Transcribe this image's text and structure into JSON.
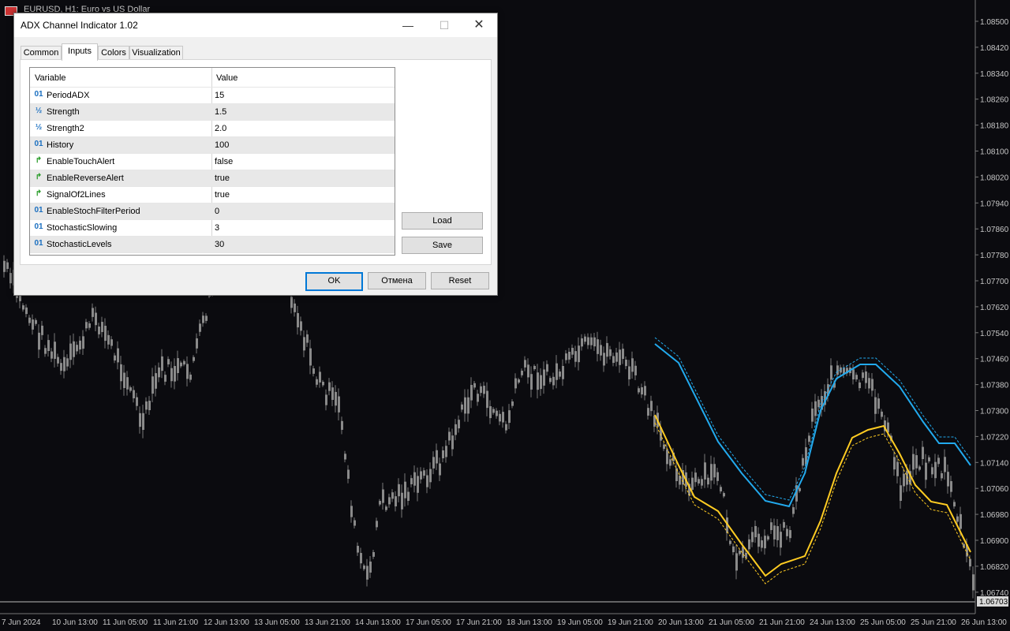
{
  "chart": {
    "title": "EURUSD, H1: Euro vs US Dollar",
    "current_price": "1.06703",
    "price_labels": [
      "1.08500",
      "1.08420",
      "1.08340",
      "1.08260",
      "1.08180",
      "1.08100",
      "1.08020",
      "1.07940",
      "1.07860",
      "1.07780",
      "1.07700",
      "1.07620",
      "1.07540",
      "1.07460",
      "1.07380",
      "1.07300",
      "1.07220",
      "1.07140",
      "1.07060",
      "1.06980",
      "1.06900",
      "1.06820",
      "1.06740"
    ],
    "time_labels": [
      "7 Jun 2024",
      "10 Jun 13:00",
      "11 Jun 05:00",
      "11 Jun 21:00",
      "12 Jun 13:00",
      "13 Jun 05:00",
      "13 Jun 21:00",
      "14 Jun 13:00",
      "17 Jun 05:00",
      "17 Jun 21:00",
      "18 Jun 13:00",
      "19 Jun 05:00",
      "19 Jun 21:00",
      "20 Jun 13:00",
      "21 Jun 05:00",
      "21 Jun 21:00",
      "24 Jun 13:00",
      "25 Jun 05:00",
      "25 Jun 21:00",
      "26 Jun 13:00"
    ],
    "colors": {
      "background": "#0b0b0f",
      "candle": "#8a8a8a",
      "upper_line": "#22aaee",
      "lower_line": "#ffcc22"
    }
  },
  "dialog": {
    "title": "ADX Channel Indicator 1.02",
    "window_controls": {
      "minimize": "—",
      "maximize": "☐",
      "close": "✕"
    },
    "tabs": [
      {
        "label": "Common"
      },
      {
        "label": "Inputs"
      },
      {
        "label": "Colors"
      },
      {
        "label": "Visualization"
      }
    ],
    "active_tab": "Inputs",
    "columns": {
      "variable": "Variable",
      "value": "Value"
    },
    "params": [
      {
        "icon": "01",
        "name": "PeriodADX",
        "value": "15"
      },
      {
        "icon": "½",
        "name": "Strength",
        "value": "1.5"
      },
      {
        "icon": "½",
        "name": "Strength2",
        "value": "2.0"
      },
      {
        "icon": "01",
        "name": "History",
        "value": "100"
      },
      {
        "icon": "↱",
        "name": "EnableTouchAlert",
        "value": "false"
      },
      {
        "icon": "↱",
        "name": "EnableReverseAlert",
        "value": "true"
      },
      {
        "icon": "↱",
        "name": "SignalOf2Lines",
        "value": "true"
      },
      {
        "icon": "01",
        "name": "EnableStochFilterPeriod",
        "value": "0"
      },
      {
        "icon": "01",
        "name": "StochasticSlowing",
        "value": "3"
      },
      {
        "icon": "01",
        "name": "StochasticLevels",
        "value": "30"
      }
    ],
    "buttons": {
      "load": "Load",
      "save": "Save",
      "ok": "OK",
      "cancel": "Отмена",
      "reset": "Reset"
    }
  }
}
